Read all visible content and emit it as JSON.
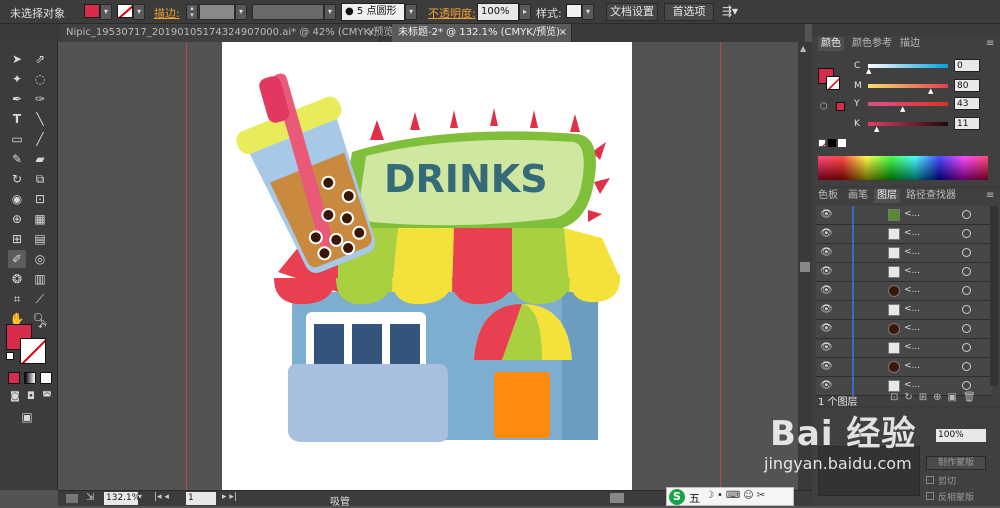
{
  "control_bar": {
    "selection_label": "未选择对象",
    "stroke_label": "描边:",
    "brush_value": "5 点圆形",
    "opacity_label": "不透明度:",
    "opacity_value": "100%",
    "style_label": "样式:",
    "doc_setup_button": "文档设置",
    "preferences_button": "首选项",
    "fill_color": "#d62b4a"
  },
  "tabs": [
    {
      "label": "Nipic_19530717_20190105174324907000.ai* @ 42% (CMYK/预览)",
      "close": "×"
    },
    {
      "label": "未标题-2* @ 132.1% (CMYK/预览)",
      "close": "×"
    }
  ],
  "status": {
    "zoom": "132.1%",
    "page": "1",
    "tool_name": "吸管"
  },
  "color_panel": {
    "tabs": [
      "颜色",
      "颜色参考",
      "描边"
    ],
    "channels": [
      {
        "name": "C",
        "value": "0"
      },
      {
        "name": "M",
        "value": "80"
      },
      {
        "name": "Y",
        "value": "43"
      },
      {
        "name": "K",
        "value": "11"
      }
    ]
  },
  "layers_panel": {
    "tabs": [
      "色板",
      "画笔",
      "图层",
      "路径查找器"
    ],
    "row_label": "<...",
    "layer_count": "1 个图层"
  },
  "transparency_panel": {
    "opacity_value": "100%",
    "make_mask_button": "制作蒙版",
    "clip_label": "剪切",
    "invert_mask_label": "反相蒙版"
  },
  "artwork": {
    "sign_text": "DRINKS"
  },
  "watermark": {
    "logo": "Bai 经验",
    "sub": "jingyan.baidu.com"
  },
  "ime": {
    "mode": "五"
  }
}
